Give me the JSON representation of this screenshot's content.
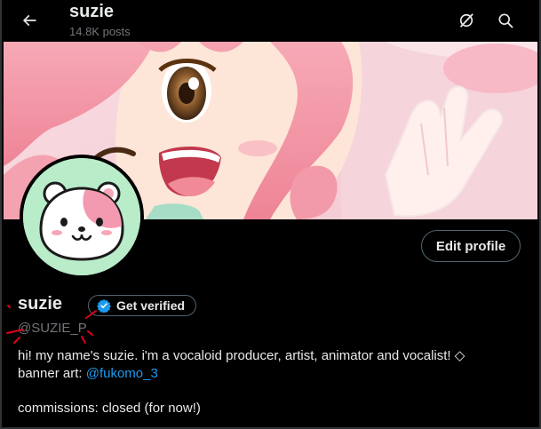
{
  "header": {
    "title": "suzie",
    "post_count": "14.8K posts"
  },
  "profile": {
    "display_name": "suzie",
    "verify_label": "Get verified",
    "handle": "@SUZIE_P",
    "edit_label": "Edit profile",
    "bio_line1": "hi! my name's suzie. i'm a vocaloid producer, artist, animator and vocalist! ◇",
    "bio_line2_prefix": "banner art: ",
    "bio_line2_link": "@fukomo_3",
    "commissions": "commissions: closed (for now!)"
  },
  "colors": {
    "background": "#000000",
    "link": "#1d9bf0",
    "verified": "#1d9bf0",
    "avatar_bg": "#b9ecc9",
    "annotation": "#e0001a"
  },
  "icons": [
    "back-arrow-icon",
    "grok-icon",
    "search-icon",
    "verified-badge-icon"
  ]
}
